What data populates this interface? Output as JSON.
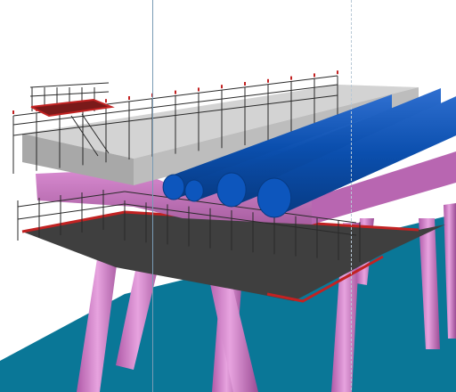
{
  "viewport": {
    "background": "#ffffff",
    "sea_color": "#0a7797",
    "legs_color": "#d482c8",
    "deck_beam_color": "#c86fc0",
    "cladding_color": "#bdbdbd",
    "pipe_color": "#0b4fae",
    "scaffold_color": "#2a2a2a",
    "platform_color": "#444444",
    "toeboard_color": "#c22222",
    "guide_color": "#7a9bb5"
  },
  "icons": {
    "pipe_bundle": "pipe-bundle",
    "scaffolding": "scaffolding",
    "jacket_legs": "jacket-legs"
  }
}
